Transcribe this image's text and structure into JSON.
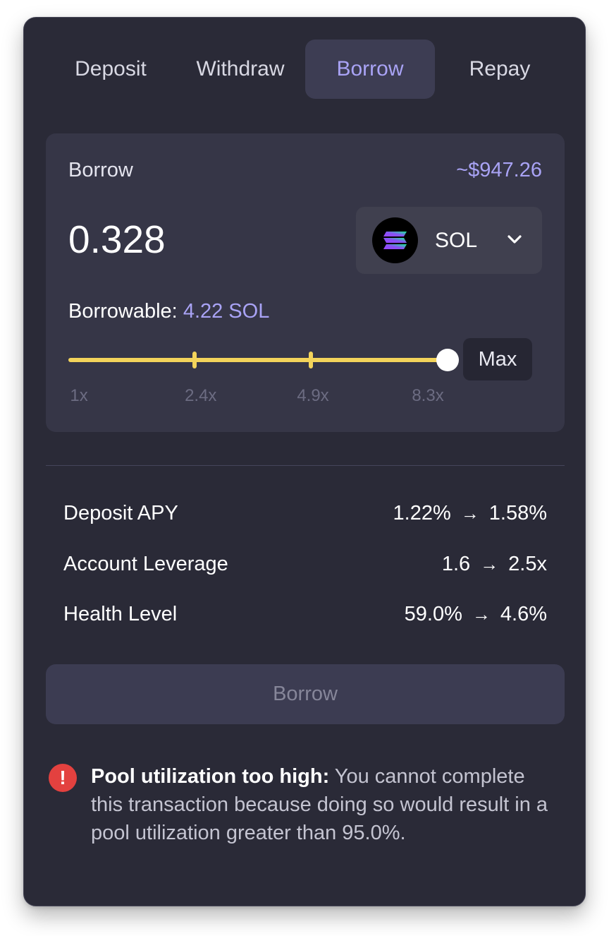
{
  "tabs": [
    {
      "label": "Deposit"
    },
    {
      "label": "Withdraw"
    },
    {
      "label": "Borrow",
      "active": true
    },
    {
      "label": "Repay"
    }
  ],
  "borrow_card": {
    "label": "Borrow",
    "usd_value": "~$947.26",
    "amount": "0.328",
    "token": {
      "symbol": "SOL",
      "icon": "solana-logo-icon"
    },
    "borrowable_label": "Borrowable:",
    "borrowable_value": "4.22 SOL",
    "slider": {
      "value_fraction": 1.0,
      "tick_fractions": [
        0.333,
        0.64
      ],
      "tick_labels": [
        "1x",
        "2.4x",
        "4.9x",
        "8.3x"
      ]
    },
    "max_label": "Max"
  },
  "stats": [
    {
      "label": "Deposit APY",
      "from": "1.22%",
      "to": "1.58%"
    },
    {
      "label": "Account Leverage",
      "from": "1.6",
      "to": "2.5x"
    },
    {
      "label": "Health Level",
      "from": "59.0%",
      "to": "4.6%"
    }
  ],
  "arrow_glyph": "→",
  "submit_label": "Borrow",
  "alert": {
    "icon": "exclamation-circle-icon",
    "title": "Pool utilization too high:",
    "message": " You cannot complete this transaction because doing so would result in a pool utilization greater than 95.0%."
  },
  "colors": {
    "panel_bg": "#2a2a37",
    "accent": "#a9a3f5",
    "slider_fill": "#f3d45b",
    "error": "#e3413f"
  }
}
